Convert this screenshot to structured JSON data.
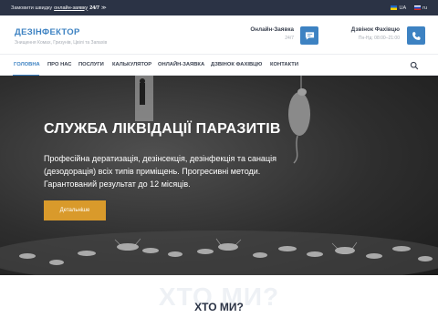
{
  "topbar": {
    "text_before": "Замовити швидку",
    "link": "онлайн-заявку",
    "hours": "24/7",
    "arrow": "≫",
    "languages": [
      {
        "code": "UA",
        "flag": "ua-flag-icon"
      },
      {
        "code": "ru",
        "flag": "ru-flag-icon"
      }
    ]
  },
  "brand": {
    "title": "ДЕЗІНФЕКТОР",
    "subtitle": "Знищення Комах, Гризунів, Цвілі та Запахів"
  },
  "contacts": {
    "order": {
      "title": "Онлайн-Заявка",
      "sub": "24/7",
      "icon": "chat-icon"
    },
    "call": {
      "title": "Дзвінок Фахівцю",
      "sub": "Пн-Нд: 08:00–21:00",
      "icon": "phone-icon"
    }
  },
  "nav": {
    "items": [
      "ГОЛОВНА",
      "ПРО НАС",
      "ПОСЛУГИ",
      "КАЛЬКУЛЯТОР",
      "ОНЛАЙН-ЗАЯВКА",
      "ДЗВІНОК ФАХІВЦЮ",
      "КОНТАКТИ"
    ],
    "active_index": 0,
    "search_icon": "search-icon"
  },
  "hero": {
    "title": "СЛУЖБА ЛІКВІДАЦІЇ ПАРАЗИТІВ",
    "text": "Професійна дератизація, дезінсекція, дезінфекція та санація (дезодорація) всіх типів приміщень. Прогресивні методи. Гарантований результат до 12 місяців.",
    "button": "Детальніше"
  },
  "about": {
    "ghost": "ХТО МИ?",
    "title": "ХТО МИ?"
  },
  "colors": {
    "accent": "#3d82c2",
    "button": "#d99a2b",
    "topbar": "#2b3345"
  }
}
